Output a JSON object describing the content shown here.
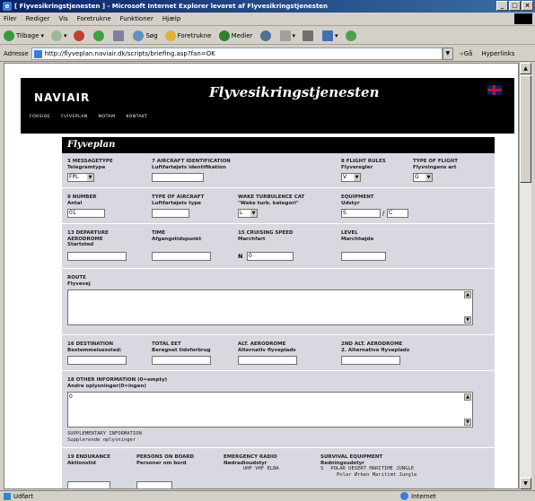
{
  "window": {
    "title": "[ Flyvesikringstjenesten ] - Microsoft Internet Explorer leveret af Flyvesikringstjenesten",
    "min": "_",
    "max": "□",
    "close": "×"
  },
  "menu": [
    "Filer",
    "Rediger",
    "Vis",
    "Foretrukne",
    "Funktioner",
    "Hjælp"
  ],
  "toolbar": {
    "back": "Tilbage",
    "search": "Søg",
    "favorites": "Foretrukne",
    "media": "Medier"
  },
  "address": {
    "label": "Adresse",
    "url": "http://flyveplan.naviair.dk/scripts/briefing.asp?fan=OK",
    "go": "Gå",
    "links": "Hyperlinks"
  },
  "site": {
    "logo": "NAVIAIR",
    "title": "Flyvesikringstjenesten",
    "nav": [
      "FORSIDE",
      "FLYVEPLAN",
      "NOTAM",
      "KONTAKT"
    ]
  },
  "form": {
    "title": "Flyveplan",
    "message_type": {
      "title": "3 MESSAGETYPE",
      "subtitle": "Telegramtype",
      "value": "FPL"
    },
    "aircraft_id": {
      "title": "7 AIRCRAFT IDENTIFICATION",
      "subtitle": "Luftfartøjets identifikation",
      "value": ""
    },
    "flight_rules": {
      "title": "8 FLIGHT RULES",
      "subtitle": "Flyveregler",
      "value": "V"
    },
    "type_of_flight": {
      "title": "TYPE OF FLIGHT",
      "subtitle": "Flyvningens art",
      "value": "G"
    },
    "number": {
      "title": "9 NUMBER",
      "subtitle": "Antal",
      "value": "01"
    },
    "type_of_aircraft": {
      "title": "TYPE OF AIRCRAFT",
      "subtitle": "Luftfartøjets type",
      "value": ""
    },
    "wake_turbulence": {
      "title": "WAKE TURBULENCE CAT",
      "subtitle": "\"Wake turb. kategori\"",
      "value": "L"
    },
    "equipment": {
      "title": "EQUIPMENT",
      "subtitle": "Udstyr",
      "value1": "S",
      "separator": "/",
      "value2": "C"
    },
    "departure": {
      "title": "13 DEPARTURE",
      "title2": "AERODROME",
      "subtitle": "Startsted",
      "value": ""
    },
    "time": {
      "title": "TIME",
      "subtitle": "Afgangstidspunkt",
      "value": ""
    },
    "cruising_speed": {
      "title": "15 CRUISING SPEED",
      "subtitle": "Marchfart",
      "prefix": "N",
      "value": "0"
    },
    "level": {
      "title": "LEVEL",
      "subtitle": "Marchhøjde",
      "value": ""
    },
    "route": {
      "title": "ROUTE",
      "subtitle": "Flyvevej",
      "value": ""
    },
    "destination": {
      "title": "16 DESTINATION",
      "subtitle": "Bestemmelsessted:",
      "value": ""
    },
    "total_eet": {
      "title": "TOTAL EET",
      "subtitle": "Beregnet tidsforbrug",
      "value": ""
    },
    "alt_aerodrome": {
      "title": "ALT. AERODROME",
      "subtitle": "Alternativ flyveplads",
      "value": ""
    },
    "alt2_aerodrome": {
      "title": "2ND ALT. AERODROME",
      "subtitle": "2. Alternative flyveplads",
      "value": ""
    },
    "other_info": {
      "title": "18 OTHER INFORMATION (0=empty)",
      "subtitle": "Andre oplysninger(0=ingen)",
      "value": "0"
    },
    "supplementary": {
      "title": "SUPPLEMENTARY INFORMATION",
      "subtitle": "Supplerende oplysninger"
    },
    "endurance": {
      "title": "19 ENDURANCE",
      "subtitle": "Aktionstid"
    },
    "persons": {
      "title": "PERSONS ON BOARD",
      "subtitle": "Personer om bord"
    },
    "emergency_radio": {
      "title": "EMERGENCY RADIO",
      "subtitle": "Nødradioudstyr",
      "options": "UHF VHF ELBA"
    },
    "survival": {
      "title": "SURVIVAL EQUIPMENT",
      "subtitle": "Redningsudstyr",
      "prefix": "S",
      "options1": "POLAR DESERT MARITIME JUNGLE",
      "options2": "Polar  Ørken  Maritimt  Jungle"
    }
  },
  "status": {
    "text": "Udført",
    "zone": "Internet"
  }
}
